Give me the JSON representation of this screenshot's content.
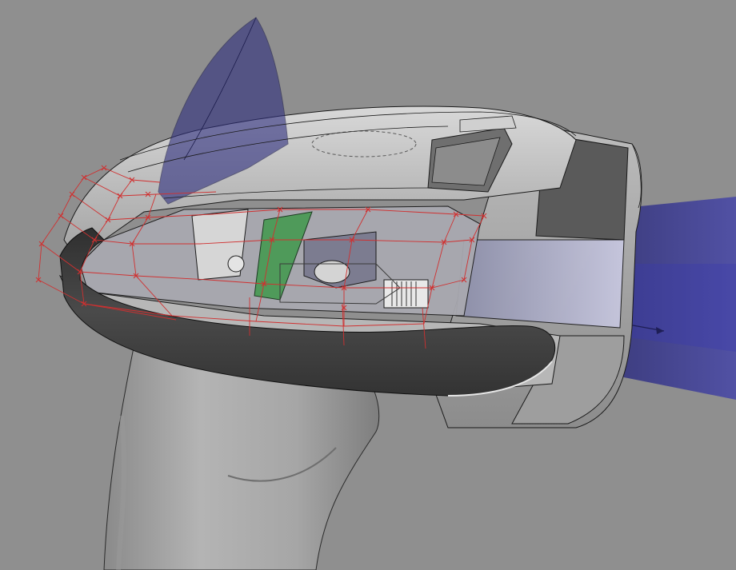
{
  "viewport": {
    "background": "#8f8f8f",
    "object": "barcode-scanner-3d-model",
    "display_mode": "shaded-with-transparency",
    "colors": {
      "housing_light": "#c9c9c9",
      "housing_mid": "#a6a6a6",
      "housing_dark": "#6b6b6b",
      "bumper": "#3d3d3d",
      "construction_plane": "#3a3a86",
      "control_cage": "#d03030",
      "pcb_green": "#4f9a5a",
      "edge_lines": "#1a1a1a"
    },
    "icons": [
      "construction-plane-icon",
      "control-point-icon",
      "direction-arrow-icon"
    ]
  }
}
